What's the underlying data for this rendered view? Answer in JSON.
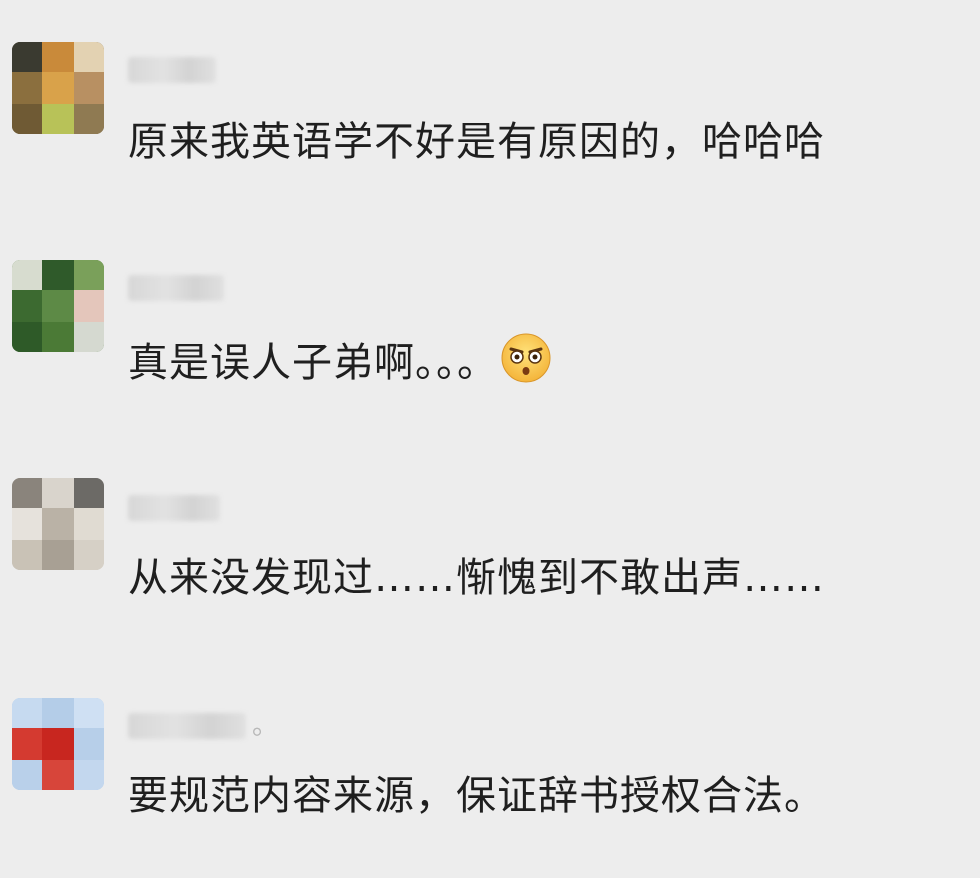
{
  "comments": [
    {
      "text": "原来我英语学不好是有原因的，哈哈哈"
    },
    {
      "text": "真是误人子弟啊。。。",
      "emoji": "shocked-face-emoji"
    },
    {
      "text": "从来没发现过……惭愧到不敢出声……"
    },
    {
      "name_suffix": "。",
      "text": "要规范内容来源，保证辞书授权合法。"
    }
  ]
}
